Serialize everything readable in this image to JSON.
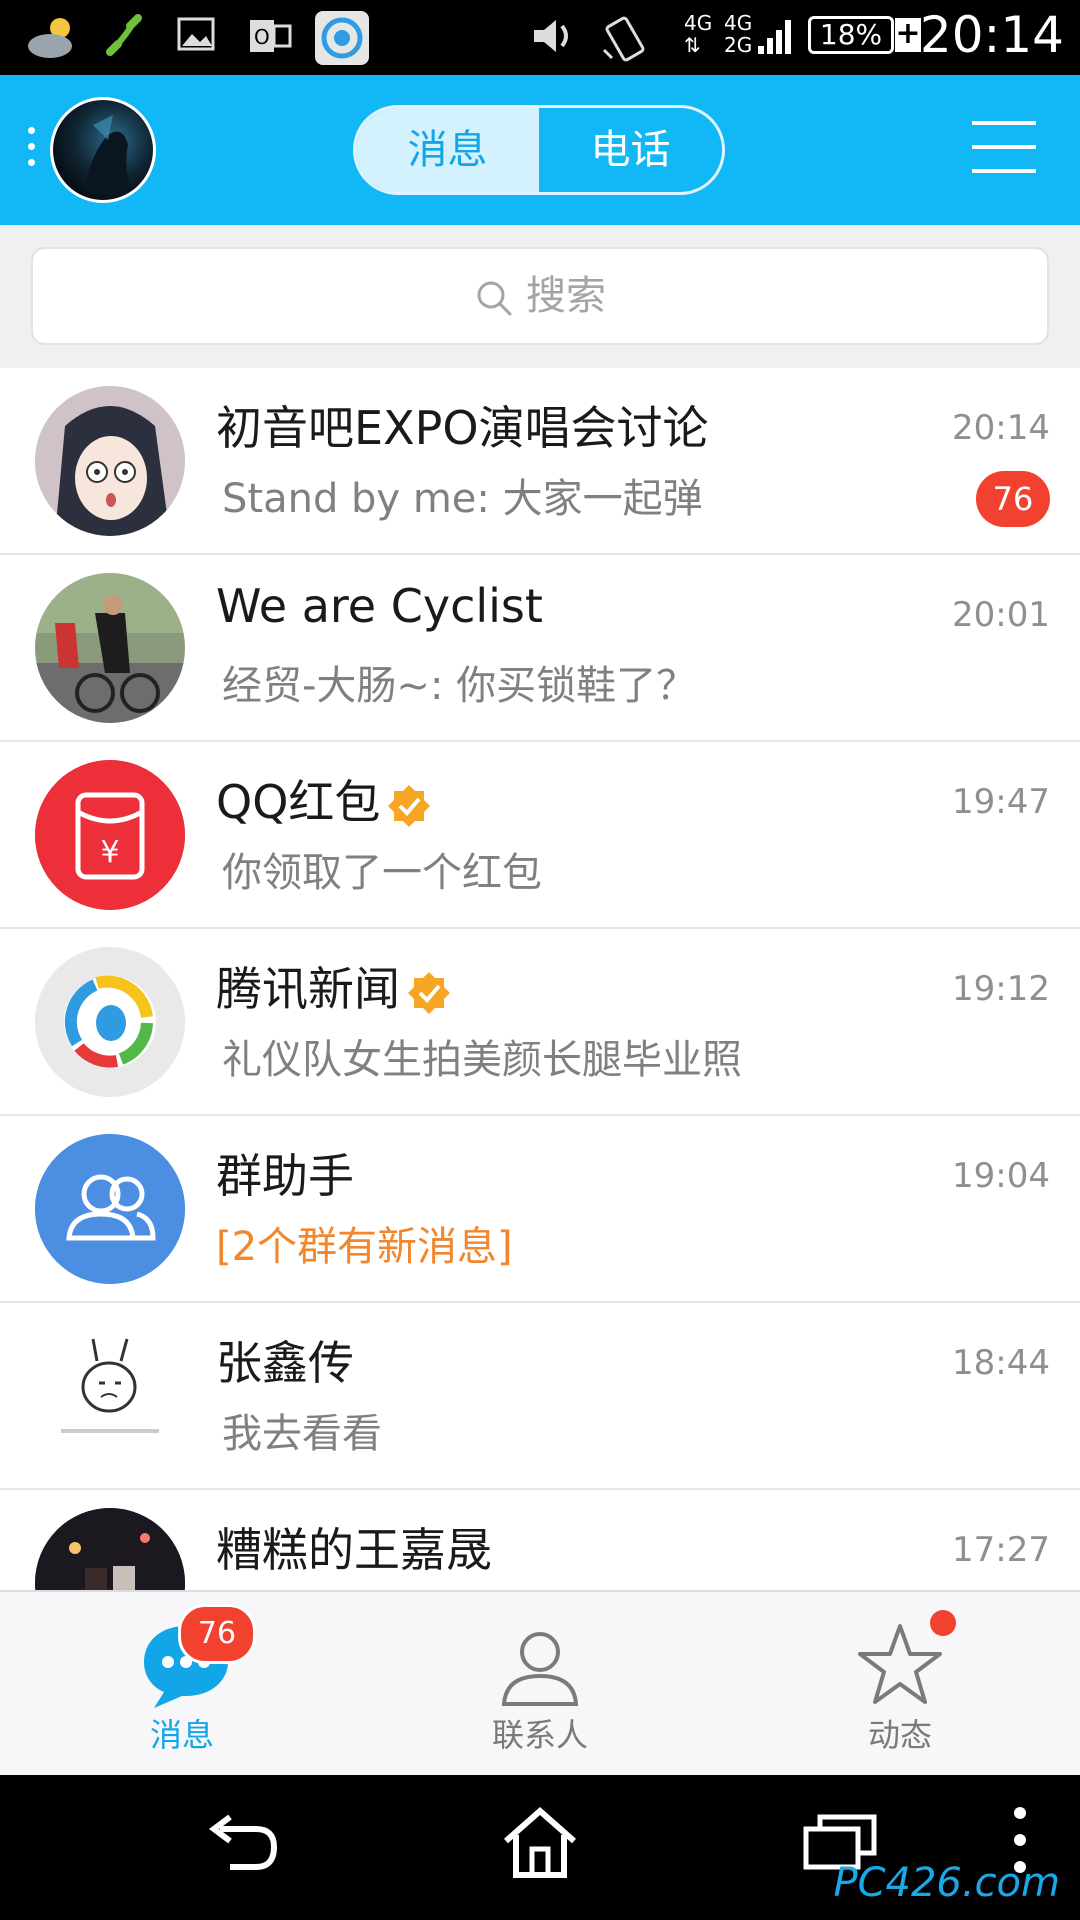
{
  "status_bar": {
    "time": "20:14",
    "battery": "18%",
    "net_top": "4G",
    "net_bottom": "4G",
    "net_2g": "2G",
    "icons": [
      "weather-icon",
      "phone-icon",
      "gallery-icon",
      "outlook-icon",
      "tencent-news-icon",
      "volume-icon",
      "vibrate-icon",
      "signal-icon",
      "battery-icon"
    ]
  },
  "header": {
    "tabs": [
      {
        "label": "消息",
        "active": true
      },
      {
        "label": "电话",
        "active": false
      }
    ]
  },
  "search": {
    "placeholder": "搜索"
  },
  "conversations": [
    {
      "name": "初音吧EXPO演唱会讨论",
      "message": "Stand by me: 大家一起弹",
      "time": "20:14",
      "badge": "76",
      "verified": false
    },
    {
      "name": "We are Cyclist",
      "message": "经贸-大肠~: 你买锁鞋了？",
      "time": "20:01",
      "verified": false
    },
    {
      "name": "QQ红包",
      "message": "你领取了一个红包",
      "time": "19:47",
      "verified": true
    },
    {
      "name": "腾讯新闻",
      "message": "礼仪队女生拍美颜长腿毕业照",
      "time": "19:12",
      "verified": true
    },
    {
      "name": "群助手",
      "message": "[2个群有新消息]",
      "time": "19:04",
      "verified": false
    },
    {
      "name": "张鑫传",
      "message": "我去看看",
      "time": "18:44",
      "verified": false
    },
    {
      "name": "糟糕的王嘉晟",
      "message": "",
      "time": "17:27",
      "verified": false
    }
  ],
  "tab_bar": {
    "tabs": [
      {
        "label": "消息",
        "badge": "76",
        "active": true
      },
      {
        "label": "联系人",
        "active": false
      },
      {
        "label": "动态",
        "active": false,
        "dot": true
      }
    ]
  },
  "colors": {
    "header": "#12b7f5",
    "badge": "#f2412e",
    "accent_orange": "#f1862c",
    "active_tab": "#12a6e8"
  },
  "watermark": "PC426.com"
}
